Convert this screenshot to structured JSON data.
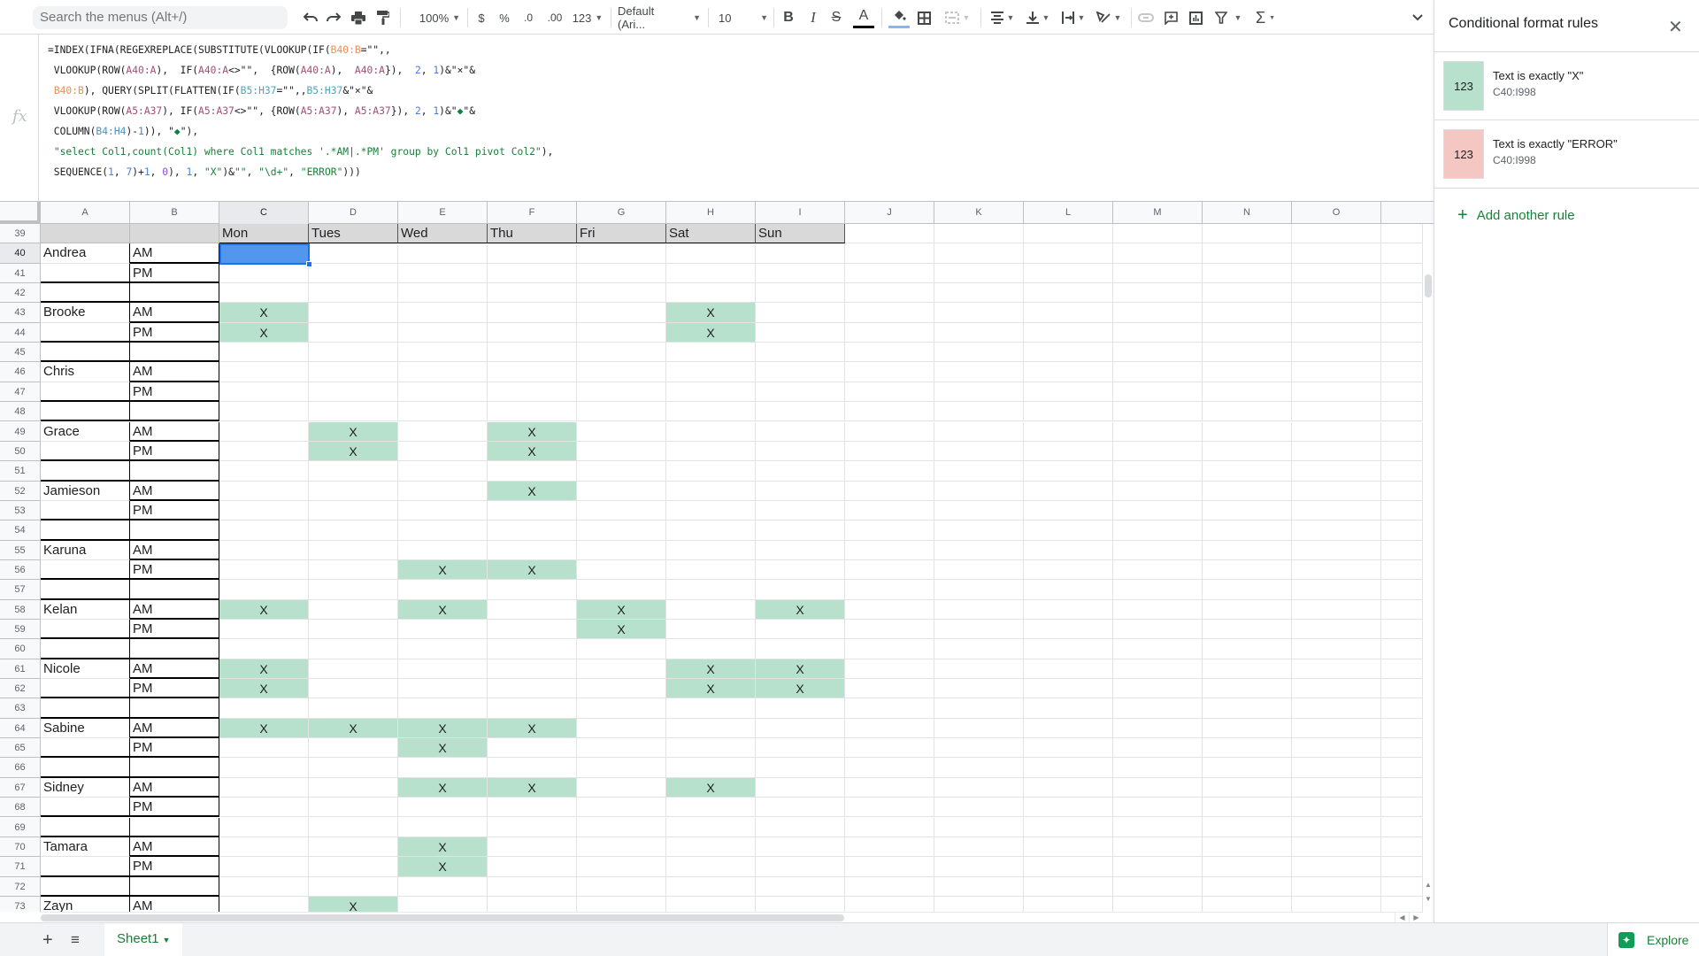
{
  "toolbar": {
    "search_placeholder": "Search the menus (Alt+/)",
    "zoom": "100%",
    "currency": "$",
    "percent": "%",
    "decrease_decimals": ".0",
    "increase_decimals": ".00",
    "more_formats": "123",
    "font": "Default (Ari...",
    "font_size": "10",
    "bold": "B",
    "italic": "I",
    "strikethrough": "S",
    "text_color": "A",
    "sum": "Σ"
  },
  "formula_bar": {
    "fx_label": "fx",
    "lines": [
      [
        [
          "=INDEX(IFNA(REGEXREPLACE(SUBSTITUTE(VLOOKUP(IF(",
          ""
        ],
        [
          "B40:B",
          "f-orange"
        ],
        [
          "=\"\",,",
          ""
        ]
      ],
      [
        [
          " VLOOKUP(ROW(",
          ""
        ],
        [
          "A40:A",
          "f-pink"
        ],
        [
          "),  IF(",
          ""
        ],
        [
          "A40:A",
          "f-pink"
        ],
        [
          "<>\"\",  {ROW(",
          ""
        ],
        [
          "A40:A",
          "f-pink"
        ],
        [
          "),  ",
          ""
        ],
        [
          "A40:A",
          "f-pink"
        ],
        [
          "}),  ",
          ""
        ],
        [
          "2",
          "f-num"
        ],
        [
          ", ",
          ""
        ],
        [
          "1",
          "f-num"
        ],
        [
          ")&\"×\"&",
          ""
        ]
      ],
      [
        [
          " ",
          ""
        ],
        [
          "B40:B",
          "f-orange"
        ],
        [
          "), QUERY(SPLIT(FLATTEN(IF(",
          ""
        ],
        [
          "B5:H37",
          "f-teal"
        ],
        [
          "=\"\",,",
          ""
        ],
        [
          "B5:H37",
          "f-teal"
        ],
        [
          "&\"×\"&",
          ""
        ]
      ],
      [
        [
          " VLOOKUP(ROW(",
          ""
        ],
        [
          "A5:A37",
          "f-pink"
        ],
        [
          "), IF(",
          ""
        ],
        [
          "A5:A37",
          "f-pink"
        ],
        [
          "<>\"\", {ROW(",
          ""
        ],
        [
          "A5:A37",
          "f-pink"
        ],
        [
          "), ",
          ""
        ],
        [
          "A5:A37",
          "f-pink"
        ],
        [
          "}), ",
          ""
        ],
        [
          "2",
          "f-num"
        ],
        [
          ", ",
          ""
        ],
        [
          "1",
          "f-num"
        ],
        [
          ")&\"",
          ""
        ],
        [
          "◆",
          "f-green"
        ],
        [
          "\"&",
          ""
        ]
      ],
      [
        [
          " COLUMN(",
          ""
        ],
        [
          "B4:H4",
          "f-blue"
        ],
        [
          ")-",
          ""
        ],
        [
          "1",
          "f-num"
        ],
        [
          ")), \"",
          ""
        ],
        [
          "◆",
          "f-green"
        ],
        [
          "\"),",
          ""
        ]
      ],
      [
        [
          " ",
          ""
        ],
        [
          "\"select Col1,count(Col1) where Col1 matches '.*AM|.*PM' group by Col1 pivot Col2\"",
          "f-str"
        ],
        [
          "),",
          ""
        ]
      ],
      [
        [
          " SEQUENCE(",
          ""
        ],
        [
          "1",
          "f-num"
        ],
        [
          ", ",
          ""
        ],
        [
          "7",
          "f-num"
        ],
        [
          ")+",
          ""
        ],
        [
          "1",
          "f-num"
        ],
        [
          ", ",
          ""
        ],
        [
          "0",
          "f-purple"
        ],
        [
          "), ",
          ""
        ],
        [
          "1",
          "f-num"
        ],
        [
          ", ",
          ""
        ],
        [
          "\"X\"",
          "f-str"
        ],
        [
          ")&",
          ""
        ],
        [
          "\"\"",
          "f-str"
        ],
        [
          ", ",
          ""
        ],
        [
          "\"\\d+\"",
          "f-str"
        ],
        [
          ", ",
          ""
        ],
        [
          "\"ERROR\"",
          "f-str"
        ],
        [
          ")))",
          ""
        ]
      ]
    ]
  },
  "grid": {
    "columns": [
      "A",
      "B",
      "C",
      "D",
      "E",
      "F",
      "G",
      "H",
      "I",
      "J",
      "K",
      "L",
      "M",
      "N",
      "O"
    ],
    "active_column": "C",
    "active_row": 40,
    "first_row": 39,
    "last_row": 73,
    "days": [
      "Mon",
      "Tues",
      "Wed",
      "Thu",
      "Fri",
      "Sat",
      "Sun"
    ],
    "people": [
      {
        "name": "Andrea",
        "row": 40,
        "am": [],
        "pm": []
      },
      {
        "name": "Brooke",
        "row": 43,
        "am": [
          "Mon",
          "Sat"
        ],
        "pm": [
          "Mon",
          "Sat"
        ]
      },
      {
        "name": "Chris",
        "row": 46,
        "am": [],
        "pm": []
      },
      {
        "name": "Grace",
        "row": 49,
        "am": [
          "Tues",
          "Thu"
        ],
        "pm": [
          "Tues",
          "Thu"
        ]
      },
      {
        "name": "Jamieson",
        "row": 52,
        "am": [
          "Thu"
        ],
        "pm": []
      },
      {
        "name": "Karuna",
        "row": 55,
        "am": [],
        "pm": [
          "Wed",
          "Thu"
        ]
      },
      {
        "name": "Kelan",
        "row": 58,
        "am": [
          "Mon",
          "Wed",
          "Fri",
          "Sun"
        ],
        "pm": [
          "Fri"
        ]
      },
      {
        "name": "Nicole",
        "row": 61,
        "am": [
          "Mon",
          "Sat",
          "Sun"
        ],
        "pm": [
          "Mon",
          "Sat",
          "Sun"
        ]
      },
      {
        "name": "Sabine",
        "row": 64,
        "am": [
          "Mon",
          "Tues",
          "Wed",
          "Thu"
        ],
        "pm": [
          "Wed"
        ]
      },
      {
        "name": "Sidney",
        "row": 67,
        "am": [
          "Wed",
          "Thu",
          "Sat"
        ],
        "pm": []
      },
      {
        "name": "Tamara",
        "row": 70,
        "am": [
          "Wed"
        ],
        "pm": [
          "Wed"
        ]
      },
      {
        "name": "Zayn",
        "row": 73,
        "am": [
          "Tues"
        ],
        "pm": []
      }
    ],
    "am_label": "AM",
    "pm_label": "PM",
    "mark": "X"
  },
  "bottom_bar": {
    "add_sheet": "+",
    "all_sheets": "≡",
    "sheet_tab": "Sheet1",
    "explore": "Explore"
  },
  "side_panel": {
    "title": "Conditional format rules",
    "rules": [
      {
        "preview": "123",
        "condition": "Text is exactly \"X\"",
        "range": "C40:I998",
        "color": "#b7e1cd"
      },
      {
        "preview": "123",
        "condition": "Text is exactly \"ERROR\"",
        "range": "C40:I998",
        "color": "#f4c7c3"
      }
    ],
    "add_rule": "Add another rule"
  },
  "colors": {
    "accent": "#188038",
    "selection": "#1a73e8",
    "x_fill": "#b7e1cd",
    "error_fill": "#f4c7c3"
  }
}
